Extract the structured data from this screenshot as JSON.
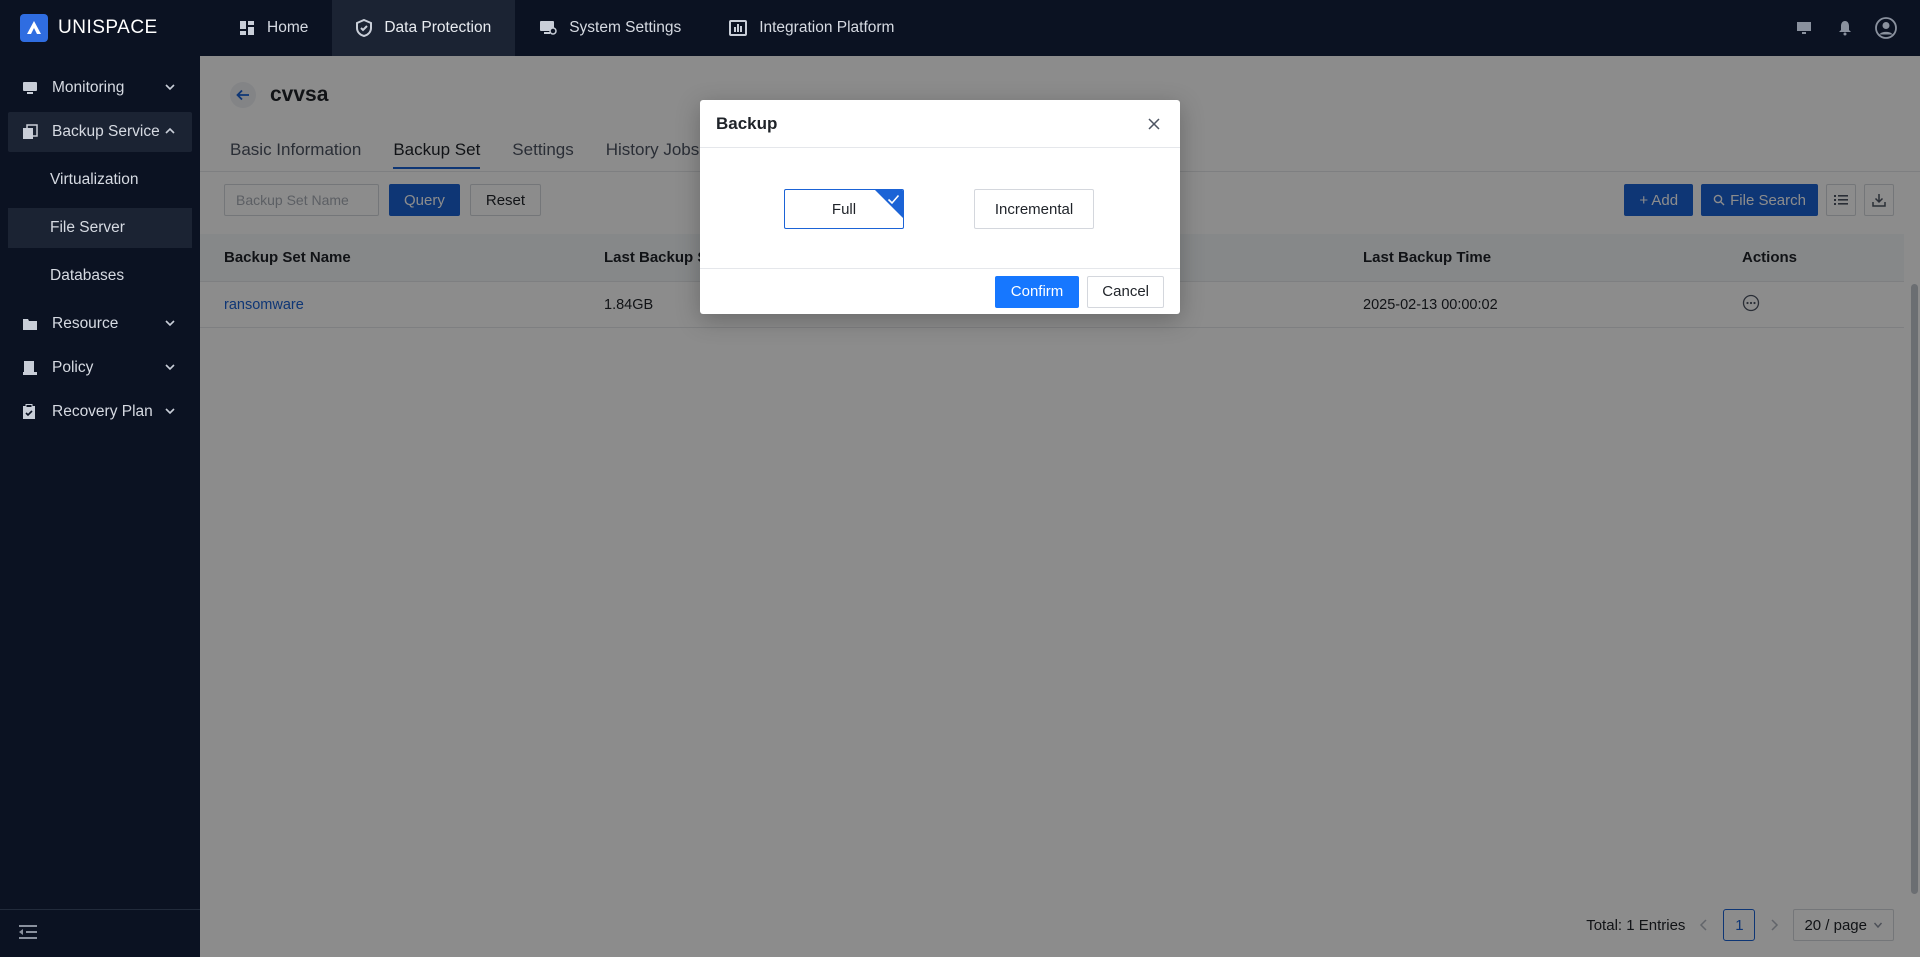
{
  "app": {
    "name": "UNISPACE"
  },
  "topnav": [
    {
      "label": "Home",
      "icon": "dashboard-icon"
    },
    {
      "label": "Data Protection",
      "icon": "shield-icon"
    },
    {
      "label": "System Settings",
      "icon": "monitor-settings-icon"
    },
    {
      "label": "Integration Platform",
      "icon": "chart-window-icon"
    }
  ],
  "sidebar": {
    "items": [
      {
        "label": "Monitoring"
      },
      {
        "label": "Backup Service"
      },
      {
        "label": "Resource"
      },
      {
        "label": "Policy"
      },
      {
        "label": "Recovery Plan"
      }
    ],
    "sub": [
      {
        "label": "Virtualization"
      },
      {
        "label": "File Server"
      },
      {
        "label": "Databases"
      }
    ]
  },
  "page": {
    "title": "cvvsa",
    "tabs": [
      "Basic Information",
      "Backup Set",
      "Settings",
      "History Jobs"
    ]
  },
  "filter": {
    "placeholder": "Backup Set Name",
    "query": "Query",
    "reset": "Reset",
    "add": "+ Add",
    "file_search": "File Search"
  },
  "table": {
    "headers": [
      "Backup Set Name",
      "Last Backup S",
      "",
      "Last Backup Time",
      "Actions"
    ],
    "rows": [
      {
        "name": "ransomware",
        "size": "1.84GB",
        "col3": "",
        "time": "2025-02-13 00:00:02"
      }
    ]
  },
  "pager": {
    "total": "Total: 1 Entries",
    "page": "1",
    "size": "20 / page"
  },
  "modal": {
    "title": "Backup",
    "options": [
      "Full",
      "Incremental"
    ],
    "selected": "Full",
    "confirm": "Confirm",
    "cancel": "Cancel"
  },
  "colors": {
    "primary": "#1b63d6",
    "confirm": "#1677ff",
    "dark": "#0b1222"
  }
}
